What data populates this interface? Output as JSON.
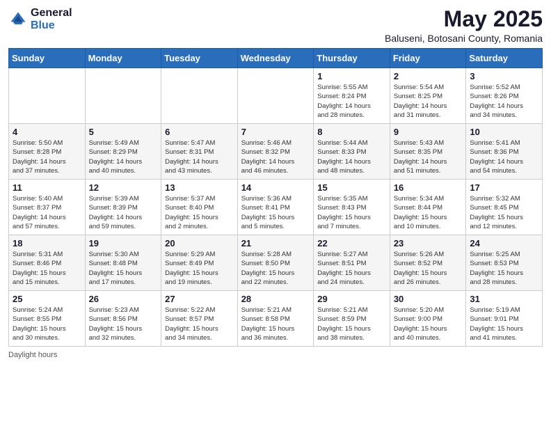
{
  "header": {
    "logo_general": "General",
    "logo_blue": "Blue",
    "month": "May 2025",
    "location": "Baluseni, Botosani County, Romania"
  },
  "weekdays": [
    "Sunday",
    "Monday",
    "Tuesday",
    "Wednesday",
    "Thursday",
    "Friday",
    "Saturday"
  ],
  "weeks": [
    [
      {
        "day": "",
        "info": ""
      },
      {
        "day": "",
        "info": ""
      },
      {
        "day": "",
        "info": ""
      },
      {
        "day": "",
        "info": ""
      },
      {
        "day": "1",
        "info": "Sunrise: 5:55 AM\nSunset: 8:24 PM\nDaylight: 14 hours\nand 28 minutes."
      },
      {
        "day": "2",
        "info": "Sunrise: 5:54 AM\nSunset: 8:25 PM\nDaylight: 14 hours\nand 31 minutes."
      },
      {
        "day": "3",
        "info": "Sunrise: 5:52 AM\nSunset: 8:26 PM\nDaylight: 14 hours\nand 34 minutes."
      }
    ],
    [
      {
        "day": "4",
        "info": "Sunrise: 5:50 AM\nSunset: 8:28 PM\nDaylight: 14 hours\nand 37 minutes."
      },
      {
        "day": "5",
        "info": "Sunrise: 5:49 AM\nSunset: 8:29 PM\nDaylight: 14 hours\nand 40 minutes."
      },
      {
        "day": "6",
        "info": "Sunrise: 5:47 AM\nSunset: 8:31 PM\nDaylight: 14 hours\nand 43 minutes."
      },
      {
        "day": "7",
        "info": "Sunrise: 5:46 AM\nSunset: 8:32 PM\nDaylight: 14 hours\nand 46 minutes."
      },
      {
        "day": "8",
        "info": "Sunrise: 5:44 AM\nSunset: 8:33 PM\nDaylight: 14 hours\nand 48 minutes."
      },
      {
        "day": "9",
        "info": "Sunrise: 5:43 AM\nSunset: 8:35 PM\nDaylight: 14 hours\nand 51 minutes."
      },
      {
        "day": "10",
        "info": "Sunrise: 5:41 AM\nSunset: 8:36 PM\nDaylight: 14 hours\nand 54 minutes."
      }
    ],
    [
      {
        "day": "11",
        "info": "Sunrise: 5:40 AM\nSunset: 8:37 PM\nDaylight: 14 hours\nand 57 minutes."
      },
      {
        "day": "12",
        "info": "Sunrise: 5:39 AM\nSunset: 8:39 PM\nDaylight: 14 hours\nand 59 minutes."
      },
      {
        "day": "13",
        "info": "Sunrise: 5:37 AM\nSunset: 8:40 PM\nDaylight: 15 hours\nand 2 minutes."
      },
      {
        "day": "14",
        "info": "Sunrise: 5:36 AM\nSunset: 8:41 PM\nDaylight: 15 hours\nand 5 minutes."
      },
      {
        "day": "15",
        "info": "Sunrise: 5:35 AM\nSunset: 8:43 PM\nDaylight: 15 hours\nand 7 minutes."
      },
      {
        "day": "16",
        "info": "Sunrise: 5:34 AM\nSunset: 8:44 PM\nDaylight: 15 hours\nand 10 minutes."
      },
      {
        "day": "17",
        "info": "Sunrise: 5:32 AM\nSunset: 8:45 PM\nDaylight: 15 hours\nand 12 minutes."
      }
    ],
    [
      {
        "day": "18",
        "info": "Sunrise: 5:31 AM\nSunset: 8:46 PM\nDaylight: 15 hours\nand 15 minutes."
      },
      {
        "day": "19",
        "info": "Sunrise: 5:30 AM\nSunset: 8:48 PM\nDaylight: 15 hours\nand 17 minutes."
      },
      {
        "day": "20",
        "info": "Sunrise: 5:29 AM\nSunset: 8:49 PM\nDaylight: 15 hours\nand 19 minutes."
      },
      {
        "day": "21",
        "info": "Sunrise: 5:28 AM\nSunset: 8:50 PM\nDaylight: 15 hours\nand 22 minutes."
      },
      {
        "day": "22",
        "info": "Sunrise: 5:27 AM\nSunset: 8:51 PM\nDaylight: 15 hours\nand 24 minutes."
      },
      {
        "day": "23",
        "info": "Sunrise: 5:26 AM\nSunset: 8:52 PM\nDaylight: 15 hours\nand 26 minutes."
      },
      {
        "day": "24",
        "info": "Sunrise: 5:25 AM\nSunset: 8:53 PM\nDaylight: 15 hours\nand 28 minutes."
      }
    ],
    [
      {
        "day": "25",
        "info": "Sunrise: 5:24 AM\nSunset: 8:55 PM\nDaylight: 15 hours\nand 30 minutes."
      },
      {
        "day": "26",
        "info": "Sunrise: 5:23 AM\nSunset: 8:56 PM\nDaylight: 15 hours\nand 32 minutes."
      },
      {
        "day": "27",
        "info": "Sunrise: 5:22 AM\nSunset: 8:57 PM\nDaylight: 15 hours\nand 34 minutes."
      },
      {
        "day": "28",
        "info": "Sunrise: 5:21 AM\nSunset: 8:58 PM\nDaylight: 15 hours\nand 36 minutes."
      },
      {
        "day": "29",
        "info": "Sunrise: 5:21 AM\nSunset: 8:59 PM\nDaylight: 15 hours\nand 38 minutes."
      },
      {
        "day": "30",
        "info": "Sunrise: 5:20 AM\nSunset: 9:00 PM\nDaylight: 15 hours\nand 40 minutes."
      },
      {
        "day": "31",
        "info": "Sunrise: 5:19 AM\nSunset: 9:01 PM\nDaylight: 15 hours\nand 41 minutes."
      }
    ]
  ],
  "footer": {
    "daylight_label": "Daylight hours"
  }
}
